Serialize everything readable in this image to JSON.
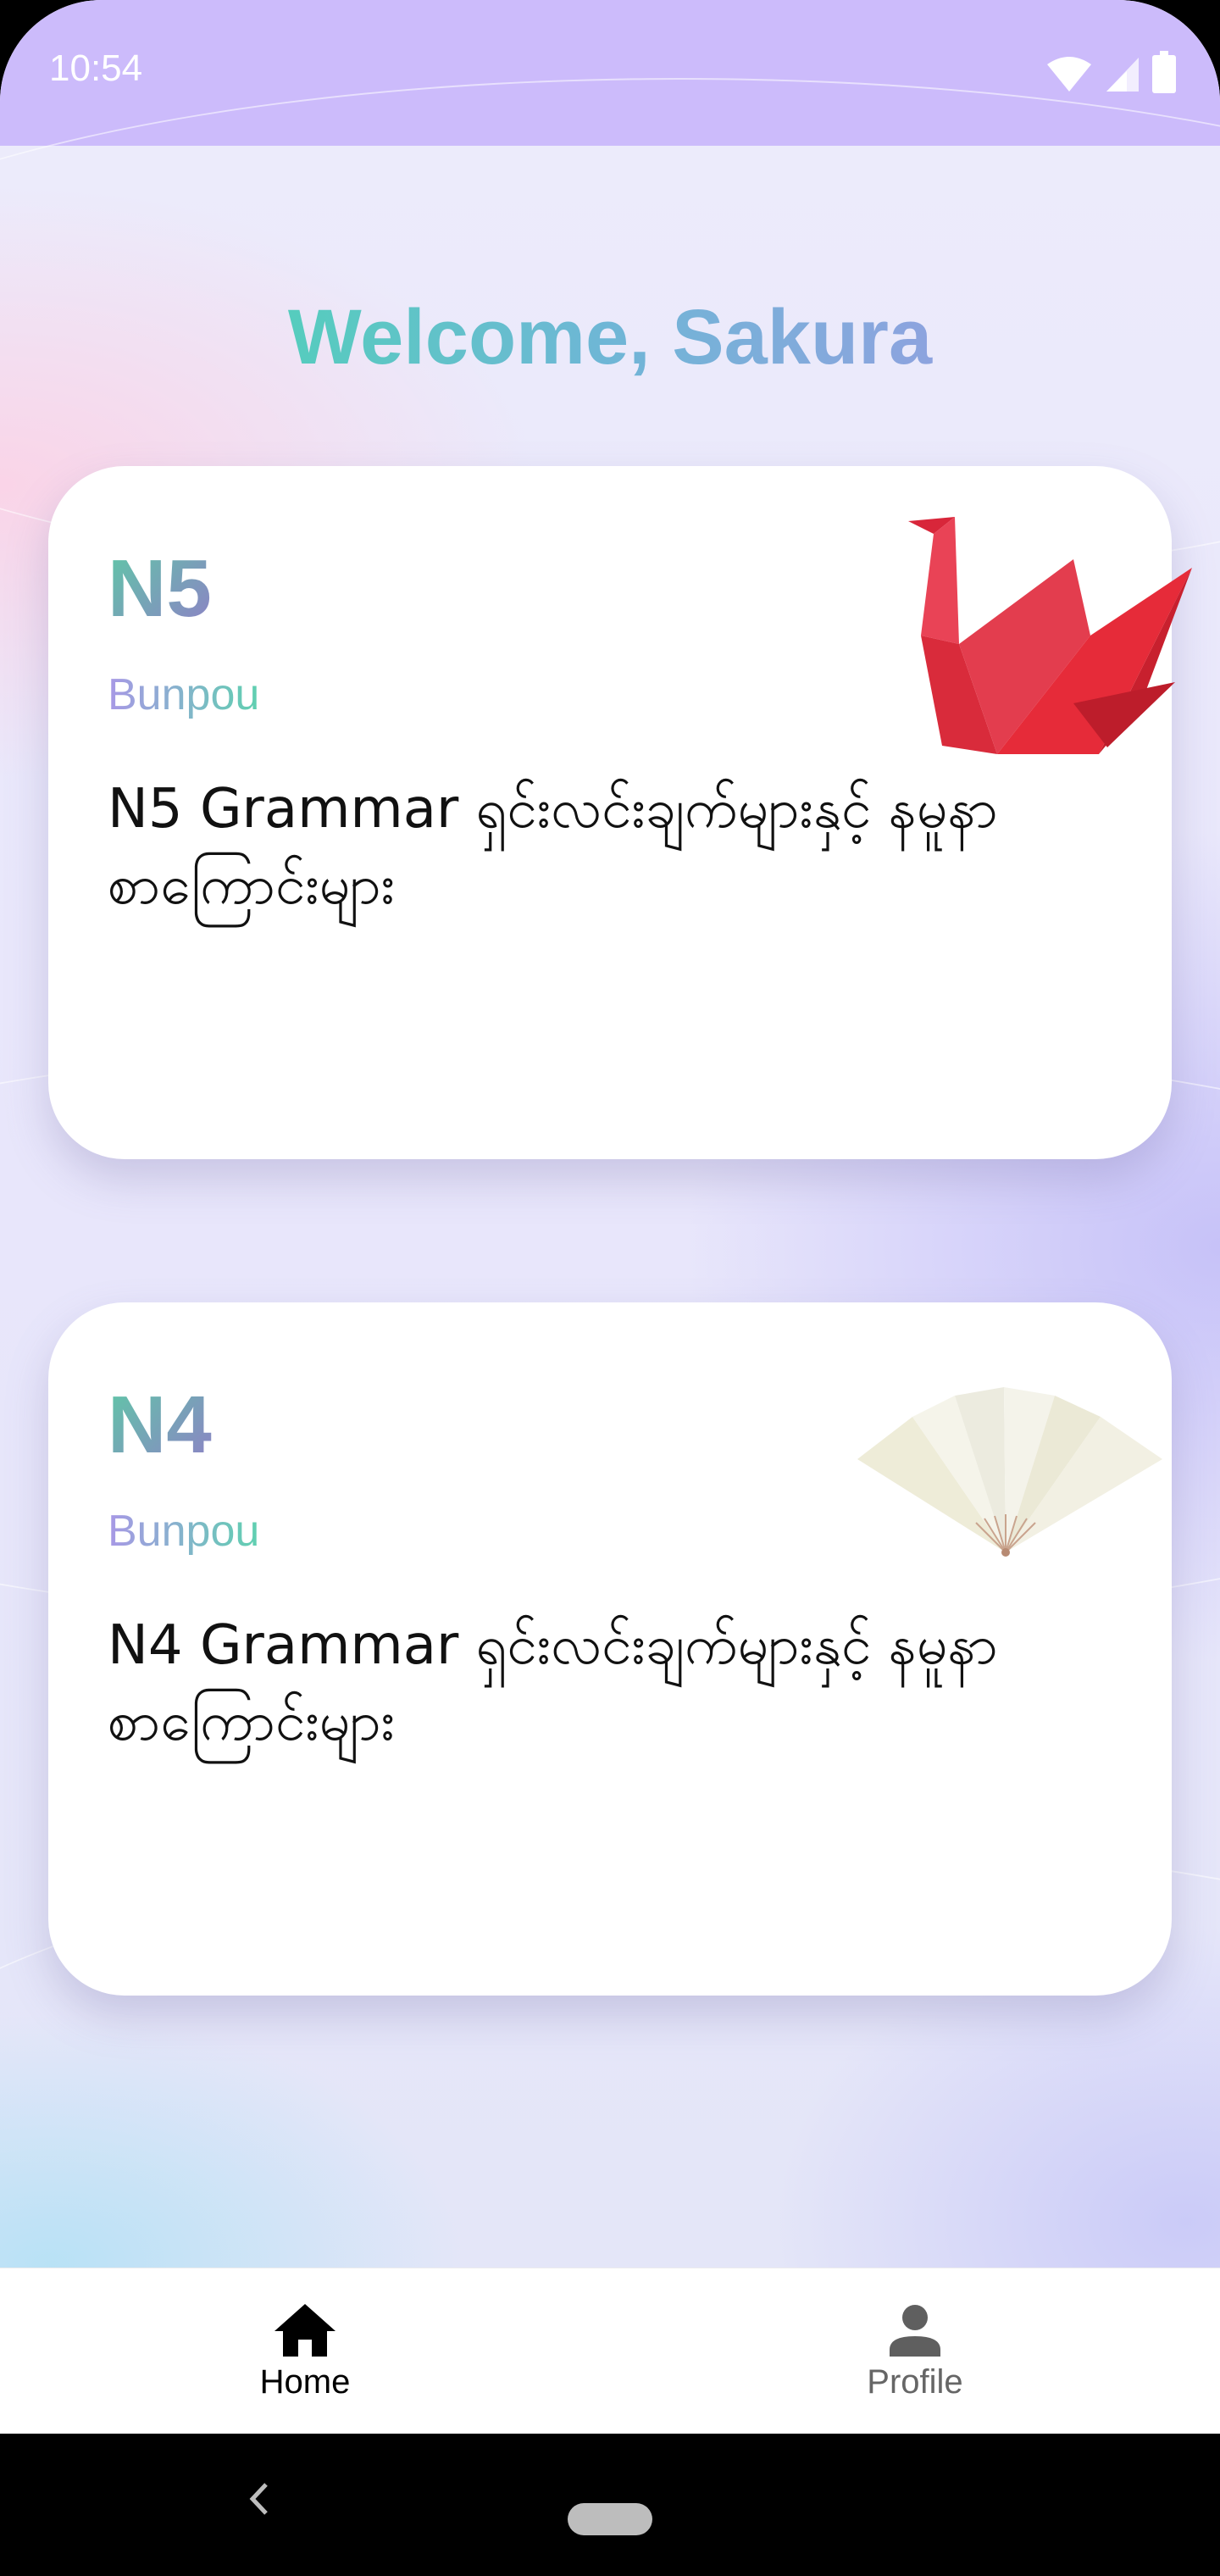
{
  "status_bar": {
    "time": "10:54",
    "icons": [
      "wifi-icon",
      "signal-icon",
      "battery-icon"
    ]
  },
  "header": {
    "welcome": "Welcome, Sakura"
  },
  "cards": [
    {
      "level": "N5",
      "subtitle": "Bunpou",
      "description": "N5 Grammar ရှင်းလင်းချက်များနှင့် နမူနာစာကြောင်းများ",
      "illustration": "origami-crane-icon"
    },
    {
      "level": "N4",
      "subtitle": "Bunpou",
      "description": "N4 Grammar ရှင်းလင်းချက်များနှင့် နမူနာစာကြောင်းများ",
      "illustration": "folding-fan-icon"
    }
  ],
  "bottom_nav": {
    "items": [
      {
        "label": "Home",
        "icon": "home-icon",
        "active": true
      },
      {
        "label": "Profile",
        "icon": "person-icon",
        "active": false
      }
    ]
  },
  "colors": {
    "status_bar": "#ccbbfb",
    "active_nav": "#000000",
    "inactive_nav": "#666666"
  }
}
